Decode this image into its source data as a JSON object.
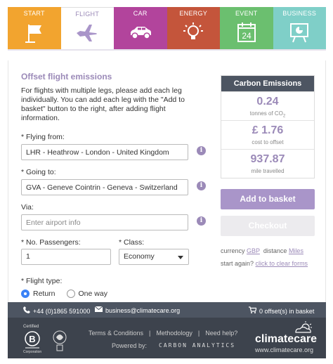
{
  "tabs": [
    {
      "label": "START",
      "icon": "flag-icon",
      "color": "#f2a42f"
    },
    {
      "label": "FLIGHT",
      "icon": "airplane-icon",
      "color": "#ffffff",
      "active": true
    },
    {
      "label": "CAR",
      "icon": "car-icon",
      "color": "#b2449c"
    },
    {
      "label": "ENERGY",
      "icon": "lightbulb-icon",
      "color": "#c4553b"
    },
    {
      "label": "EVENT",
      "icon": "calendar-icon",
      "color": "#6bbf6f",
      "calendar_day": "24"
    },
    {
      "label": "BUSINESS",
      "icon": "presentation-icon",
      "color": "#7fcfc8"
    }
  ],
  "form": {
    "title": "Offset flight emissions",
    "intro": "For flights with multiple legs, please add each leg individually. You can add each leg with the \"Add to basket\" button to the right, after adding flight information.",
    "flying_from_label": "* Flying from:",
    "flying_from_value": "LHR - Heathrow - London - United Kingdom",
    "going_to_label": "* Going to:",
    "going_to_value": "GVA - Geneve Cointrin - Geneva - Switzerland",
    "via_label": "Via:",
    "via_placeholder": "Enter airport info",
    "passengers_label": "* No. Passengers:",
    "passengers_value": "1",
    "class_label": "* Class:",
    "class_value": "Economy",
    "flight_type_label": "* Flight type:",
    "return_label": "Return",
    "one_way_label": "One way",
    "info_glyph": "i"
  },
  "emissions": {
    "header": "Carbon Emissions",
    "tonnes_value": "0.24",
    "tonnes_unit": "tonnes of CO",
    "tonnes_unit_sub": "2",
    "cost_value": "£ 1.76",
    "cost_unit": "cost to offset",
    "miles_value": "937.87",
    "miles_unit": "mile travelled",
    "add_to_basket": "Add to basket",
    "checkout": "Checkout",
    "currency_label": "currency",
    "currency_value": "GBP",
    "distance_label": "distance",
    "distance_value": "Miles",
    "start_again": "start again?",
    "clear_forms": "click to clear forms"
  },
  "contact": {
    "phone": "+44 (0)1865 591000",
    "email": "business@climatecare.org",
    "basket": "0 offset(s) in basket"
  },
  "footer": {
    "certified": "Certified",
    "b_letter": "B",
    "corporation": "Corporation",
    "terms": "Terms & Conditions",
    "methodology": "Methodology",
    "help": "Need help?",
    "separator": "|",
    "powered_by": "Powered by:",
    "carbon_analytics": "CARBON ANALYTICS",
    "brand": "climatecare",
    "brand_url": "www.climatecare.org"
  },
  "colors": {
    "accent": "#9b8ab8",
    "bar": "#4d5562",
    "footer": "#3d434d"
  }
}
